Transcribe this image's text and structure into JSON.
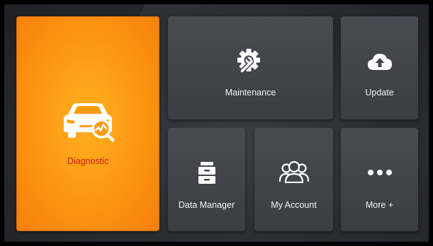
{
  "tiles": {
    "diagnostic": {
      "label": "Diagnostic",
      "icon": "car-diagnostic-icon"
    },
    "maintenance": {
      "label": "Maintenance",
      "icon": "gear-wrench-icon"
    },
    "update": {
      "label": "Update",
      "icon": "cloud-upload-icon"
    },
    "data_manager": {
      "label": "Data Manager",
      "icon": "file-cabinet-icon"
    },
    "my_account": {
      "label": "My Account",
      "icon": "users-icon"
    },
    "more": {
      "label": "More +",
      "icon": "ellipsis-icon"
    }
  },
  "colors": {
    "diagnostic_bg": "#fd9a13",
    "diagnostic_label": "#cf1d14",
    "tile_bg": "#44464d",
    "label_text": "#f2f2f2",
    "icon_white": "#ffffff"
  }
}
